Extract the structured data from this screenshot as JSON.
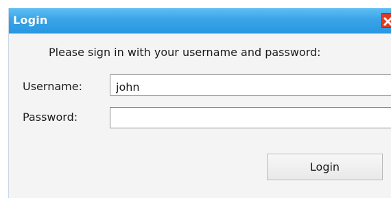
{
  "window": {
    "title": "Login"
  },
  "form": {
    "prompt": "Please sign in with your username and password:",
    "username_label": "Username:",
    "username_value": "john",
    "password_label": "Password:",
    "password_value": ""
  },
  "actions": {
    "login_label": "Login"
  },
  "icons": {
    "close": "close-icon"
  },
  "colors": {
    "titlebar": "#3aa4e8",
    "close": "#e23a1e"
  }
}
